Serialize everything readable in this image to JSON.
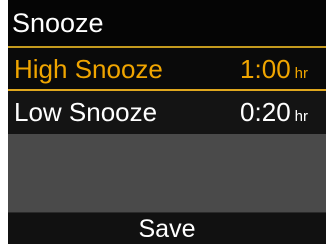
{
  "header": {
    "title": "Snooze"
  },
  "rows": [
    {
      "label": "High Snooze",
      "value": "1:00",
      "unit": "hr",
      "selected": true
    },
    {
      "label": "Low Snooze",
      "value": "0:20",
      "unit": "hr",
      "selected": false
    }
  ],
  "footer": {
    "save_label": "Save"
  },
  "colors": {
    "accent": "#f0a500",
    "header_bg": "#050505",
    "body_bg": "#4a4a4a"
  }
}
